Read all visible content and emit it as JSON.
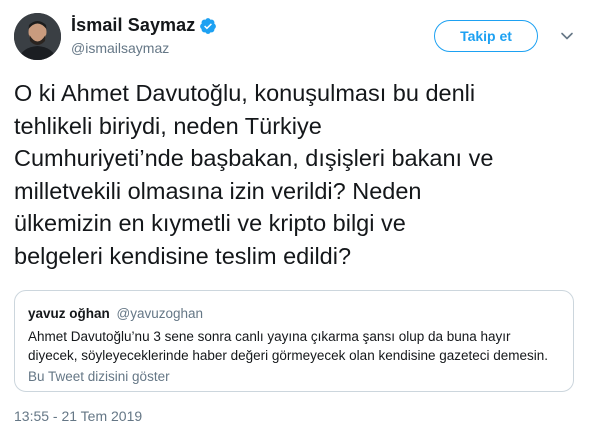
{
  "author": {
    "display_name": "İsmail Saymaz",
    "handle": "@ismailsaymaz",
    "verified": true,
    "avatar_icon": "avatar-photo"
  },
  "actions": {
    "follow_label": "Takip et",
    "menu_icon": "chevron-down-icon"
  },
  "tweet": {
    "text_lines": [
      "O ki Ahmet Davutoğlu, konuşulması bu denli",
      "tehlikeli biriydi, neden Türkiye",
      "Cumhuriyeti’nde başbakan, dışişleri bakanı ve",
      "milletvekili olmasına izin verildi? Neden",
      "ülkemizin en kıymetli ve kripto bilgi ve",
      "belgeleri kendisine teslim edildi?"
    ],
    "timestamp": "13:55 - 21 Tem 2019"
  },
  "quoted_tweet": {
    "display_name": "yavuz oğhan",
    "handle": "@yavuzoghan",
    "text_lines": [
      "Ahmet Davutoğlu’nu 3 sene sonra canlı yayına çıkarma şansı olup da buna hayır",
      "diyecek, söyleyeceklerinde haber değeri görmeyecek olan kendisine gazeteci demesin."
    ],
    "thread_link": "Bu Tweet dizisini göster"
  },
  "colors": {
    "accent": "#1da1f2",
    "secondary_text": "#657786",
    "border": "#ccd6dd"
  }
}
